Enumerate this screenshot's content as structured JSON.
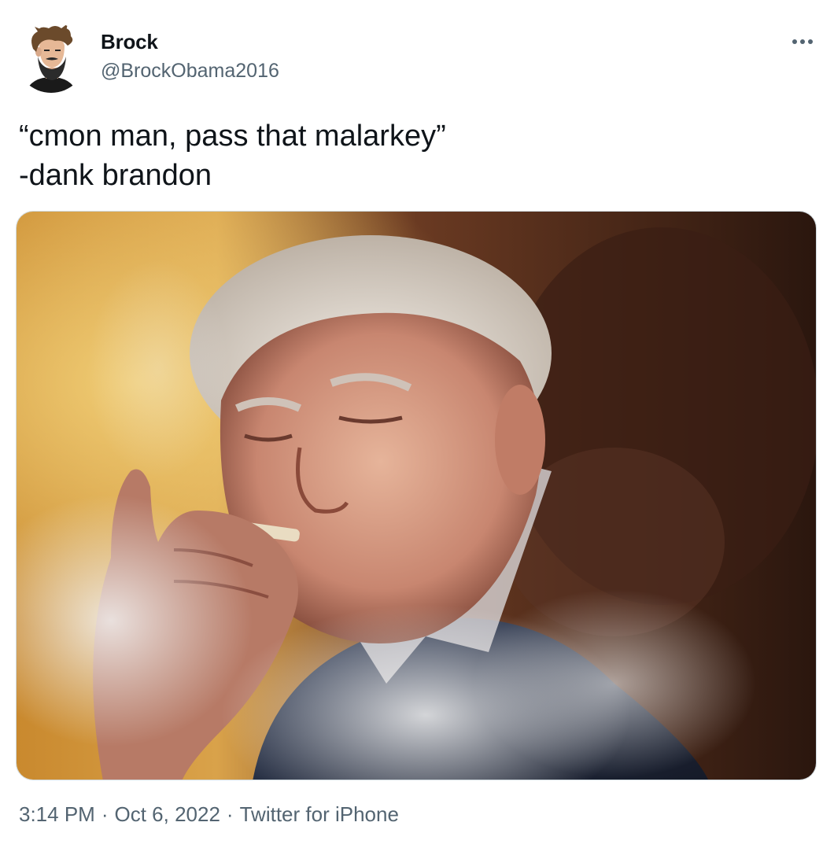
{
  "user": {
    "name": "Brock",
    "handle": "@BrockObama2016",
    "avatar_icon": "bearded-man-avatar-icon"
  },
  "tweet": {
    "text_lines": [
      "“cmon man, pass that malarkey”",
      "-dank brandon"
    ]
  },
  "media": {
    "type": "photo",
    "icon": "photo-icon"
  },
  "meta": {
    "time": "3:14 PM",
    "separator": "·",
    "date": "Oct 6, 2022",
    "source": "Twitter for iPhone"
  },
  "more_icon": "more-dots-icon",
  "colors": {
    "text_primary": "#0f1419",
    "text_secondary": "#536471",
    "border": "#cfd9de"
  }
}
